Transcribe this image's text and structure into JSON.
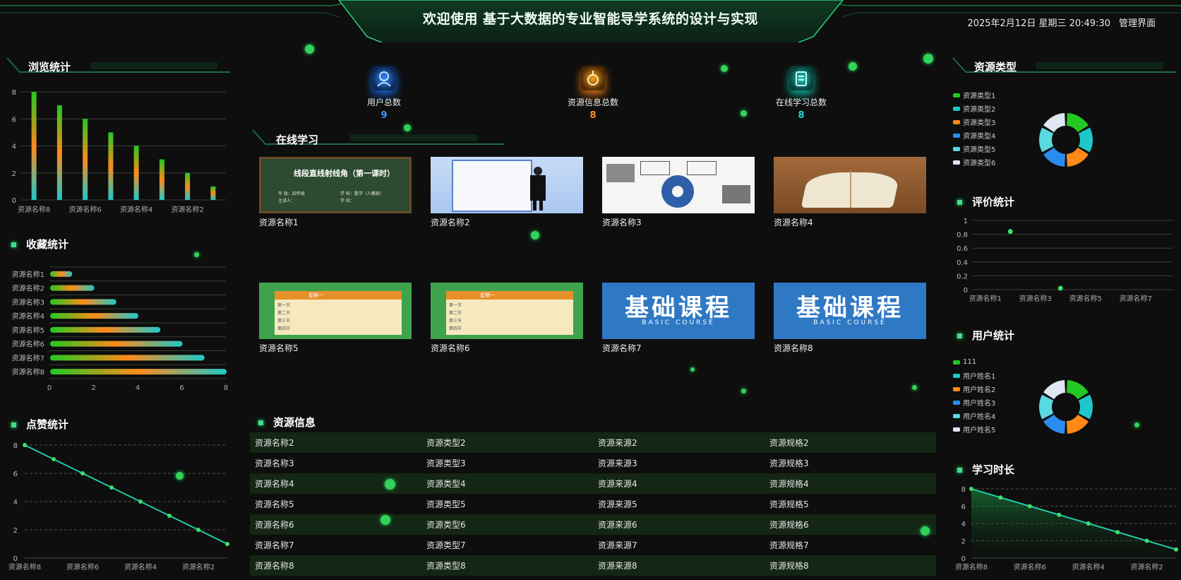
{
  "header": {
    "title": "欢迎使用 基于大数据的专业智能导学系统的设计与实现",
    "datetime": "2025年2月12日 星期三 20:49:30",
    "admin_link": "管理界面"
  },
  "panels": {
    "browse": "浏览统计",
    "favorite": "收藏统计",
    "likes": "点赞统计",
    "online": "在线学习",
    "resource_info": "资源信息",
    "resource_type": "资源类型",
    "rating": "评价统计",
    "user_stats": "用户统计",
    "study_time": "学习时长"
  },
  "stats": [
    {
      "label": "用户总数",
      "value": "9",
      "color": "#3a9cff",
      "icon": "user-icon"
    },
    {
      "label": "资源信息总数",
      "value": "8",
      "color": "#ff8c1a",
      "icon": "resource-icon"
    },
    {
      "label": "在线学习总数",
      "value": "8",
      "color": "#22d3d3",
      "icon": "study-icon"
    }
  ],
  "cards": [
    {
      "name": "资源名称1",
      "thumb": "线段直线射线角（第一课时）",
      "thumb_lines": [
        "年  级：四年级",
        "学  科：数学（人教版）",
        "主讲人：",
        "学  校："
      ]
    },
    {
      "name": "资源名称2"
    },
    {
      "name": "资源名称3"
    },
    {
      "name": "资源名称4"
    },
    {
      "name": "资源名称5",
      "schedule_rows": [
        "第一节",
        "第二节",
        "第三节",
        "第四节"
      ],
      "schedule_head": "星期一"
    },
    {
      "name": "资源名称6",
      "schedule_rows": [
        "第一节",
        "第二节",
        "第三节",
        "第四节"
      ],
      "schedule_head": "星期一"
    },
    {
      "name": "资源名称7",
      "banner": "基础课程",
      "banner_sub": "BASIC COURSE"
    },
    {
      "name": "资源名称8",
      "banner": "基础课程",
      "banner_sub": "BASIC COURSE"
    }
  ],
  "table": {
    "rows": [
      [
        "资源名称2",
        "资源类型2",
        "资源来源2",
        "资源规格2"
      ],
      [
        "资源名称3",
        "资源类型3",
        "资源来源3",
        "资源规格3"
      ],
      [
        "资源名称4",
        "资源类型4",
        "资源来源4",
        "资源规格4"
      ],
      [
        "资源名称5",
        "资源类型5",
        "资源来源5",
        "资源规格5"
      ],
      [
        "资源名称6",
        "资源类型6",
        "资源来源6",
        "资源规格6"
      ],
      [
        "资源名称7",
        "资源类型7",
        "资源来源7",
        "资源规格7"
      ],
      [
        "资源名称8",
        "资源类型8",
        "资源来源8",
        "资源规格8"
      ]
    ]
  },
  "chart_data": [
    {
      "id": "browse",
      "type": "bar",
      "categories": [
        "资源名称8",
        "资源名称7",
        "资源名称6",
        "资源名称5",
        "资源名称4",
        "资源名称3",
        "资源名称2",
        "资源名称1"
      ],
      "tick_labels": [
        "资源名称8",
        "资源名称6",
        "资源名称4",
        "资源名称2"
      ],
      "values": [
        8,
        7,
        6,
        5,
        4,
        3,
        2,
        1
      ],
      "ylim": [
        0,
        8
      ],
      "yticks": [
        0,
        2,
        4,
        6,
        8
      ],
      "grid": true
    },
    {
      "id": "favorite",
      "type": "bar",
      "orientation": "horizontal",
      "categories": [
        "资源名称1",
        "资源名称2",
        "资源名称3",
        "资源名称4",
        "资源名称5",
        "资源名称6",
        "资源名称7",
        "资源名称8"
      ],
      "values": [
        1,
        2,
        3,
        4,
        5,
        6,
        7,
        8
      ],
      "xlim": [
        0,
        8
      ],
      "xticks": [
        0,
        2,
        4,
        6,
        8
      ]
    },
    {
      "id": "likes",
      "type": "line",
      "categories": [
        "资源名称8",
        "资源名称7",
        "资源名称6",
        "资源名称5",
        "资源名称4",
        "资源名称3",
        "资源名称2",
        "资源名称1"
      ],
      "tick_labels": [
        "资源名称8",
        "资源名称6",
        "资源名称4",
        "资源名称2"
      ],
      "values": [
        8,
        7,
        6,
        5,
        4,
        3,
        2,
        1
      ],
      "ylim": [
        0,
        8
      ],
      "yticks": [
        0,
        2,
        4,
        6,
        8
      ]
    },
    {
      "id": "resource_type",
      "type": "pie",
      "labels": [
        "资源类型1",
        "资源类型2",
        "资源类型3",
        "资源类型4",
        "资源类型5",
        "资源类型6"
      ],
      "values": [
        1,
        1,
        1,
        1,
        1,
        1
      ],
      "colors": [
        "#22c922",
        "#1fc8c8",
        "#ff8a1a",
        "#2a8cf0",
        "#59d9e0",
        "#dfe6f2"
      ]
    },
    {
      "id": "rating",
      "type": "scatter",
      "categories": [
        "资源名称1",
        "资源名称2",
        "资源名称3",
        "资源名称4",
        "资源名称5",
        "资源名称6",
        "资源名称7",
        "资源名称8"
      ],
      "tick_labels": [
        "资源名称1",
        "资源名称3",
        "资源名称5",
        "资源名称7"
      ],
      "points": [
        {
          "x": "资源名称2",
          "y": 0.84
        },
        {
          "x": "资源名称4",
          "y": 0.02
        }
      ],
      "ylim": [
        0,
        1
      ],
      "yticks": [
        0,
        0.2,
        0.4,
        0.6,
        0.8,
        1
      ]
    },
    {
      "id": "user_stats",
      "type": "pie",
      "labels": [
        "111",
        "用户姓名1",
        "用户姓名2",
        "用户姓名3",
        "用户姓名4",
        "用户姓名5"
      ],
      "values": [
        1,
        1,
        1,
        1,
        1,
        1
      ],
      "colors": [
        "#22c922",
        "#1fc8c8",
        "#ff8a1a",
        "#2a8cf0",
        "#59d9e0",
        "#dfe6f2"
      ]
    },
    {
      "id": "study_time",
      "type": "area",
      "categories": [
        "资源名称8",
        "资源名称7",
        "资源名称6",
        "资源名称5",
        "资源名称4",
        "资源名称3",
        "资源名称2",
        "资源名称1"
      ],
      "tick_labels": [
        "资源名称8",
        "资源名称6",
        "资源名称4",
        "资源名称2"
      ],
      "values": [
        8,
        7,
        6,
        5,
        4,
        3,
        2,
        1
      ],
      "ylim": [
        0,
        8
      ],
      "yticks": [
        0,
        2,
        4,
        6,
        8
      ]
    }
  ]
}
